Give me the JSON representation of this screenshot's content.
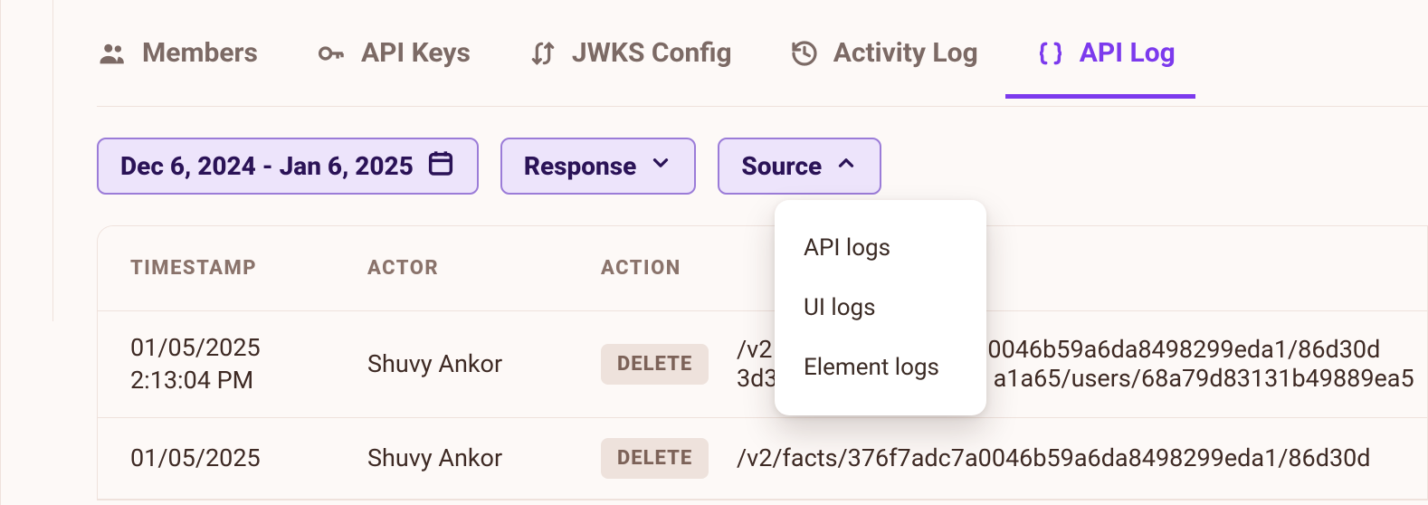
{
  "tabs": [
    {
      "label": "Members",
      "icon": "members-icon"
    },
    {
      "label": "API Keys",
      "icon": "key-icon"
    },
    {
      "label": "JWKS Config",
      "icon": "arrows-icon"
    },
    {
      "label": "Activity Log",
      "icon": "history-icon"
    },
    {
      "label": "API Log",
      "icon": "braces-icon",
      "active": true
    }
  ],
  "filters": {
    "date_range": {
      "label": "Dec 6, 2024 - Jan 6, 2025"
    },
    "response": {
      "label": "Response",
      "open": false
    },
    "source": {
      "label": "Source",
      "open": true,
      "options": [
        "API logs",
        "UI logs",
        "Element logs"
      ]
    }
  },
  "table": {
    "columns": [
      "TIMESTAMP",
      "ACTOR",
      "ACTION",
      ""
    ],
    "rows": [
      {
        "ts_date": "01/05/2025",
        "ts_time": "2:13:04 PM",
        "actor": "Shuvy Ankor",
        "action": "DELETE",
        "resource_line1": "/v2",
        "resource_line2": "3d3",
        "resource_tail1": "0046b59a6da8498299eda1/86d30d",
        "resource_tail2": "a1a65/users/68a79d83131b49889ea5"
      },
      {
        "ts_date": "01/05/2025",
        "ts_time": "",
        "actor": "Shuvy Ankor",
        "action": "DELETE",
        "resource_line1": "/v2/facts/376f7adc7a0046b59a6da8498299eda1/86d30d",
        "resource_line2": "",
        "resource_tail1": "",
        "resource_tail2": ""
      }
    ]
  }
}
